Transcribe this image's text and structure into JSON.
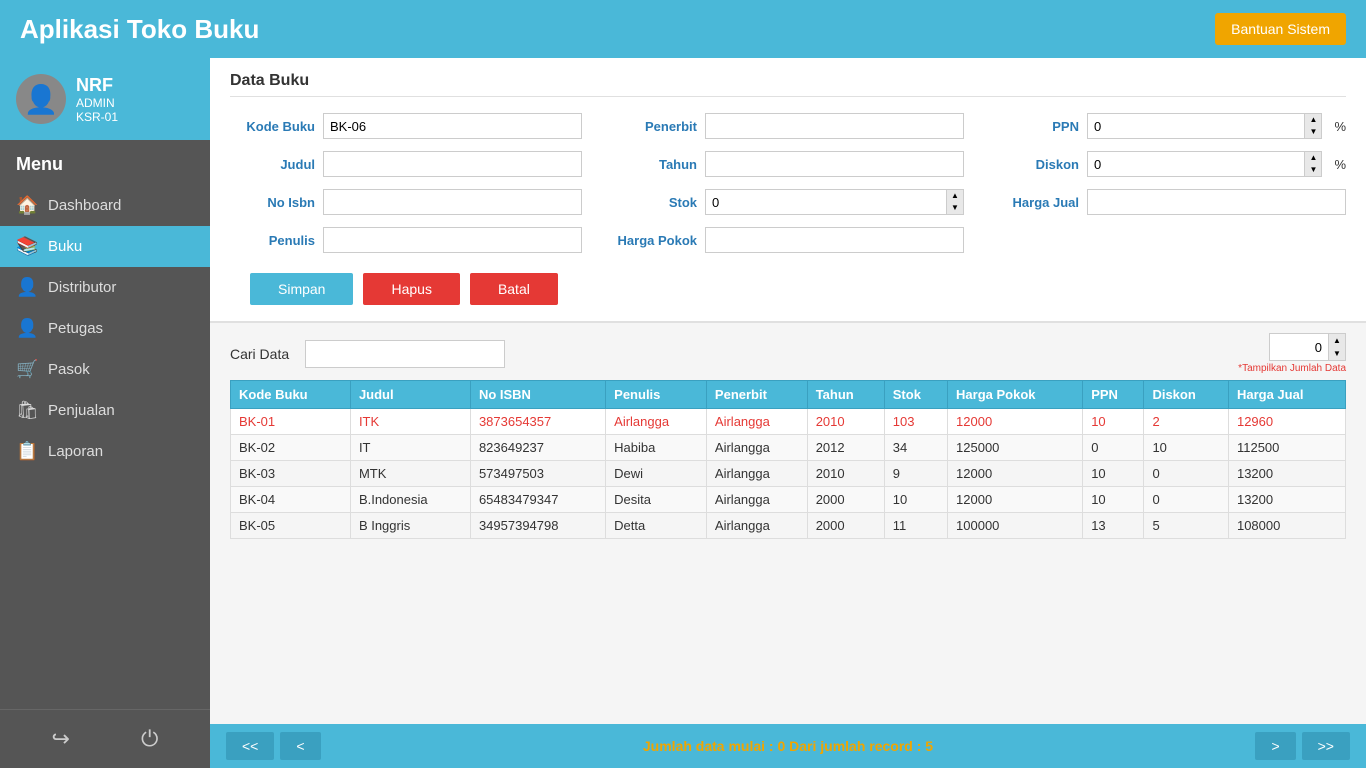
{
  "app": {
    "title": "Aplikasi Toko Buku",
    "help_btn": "Bantuan Sistem"
  },
  "sidebar": {
    "user": {
      "name": "NRF",
      "role": "ADMIN",
      "id": "KSR-01"
    },
    "menu_header": "Menu",
    "items": [
      {
        "id": "dashboard",
        "label": "Dashboard",
        "icon": "🏠"
      },
      {
        "id": "buku",
        "label": "Buku",
        "icon": "📚"
      },
      {
        "id": "distributor",
        "label": "Distributor",
        "icon": "👤"
      },
      {
        "id": "petugas",
        "label": "Petugas",
        "icon": "👤"
      },
      {
        "id": "pasok",
        "label": "Pasok",
        "icon": "🛒"
      },
      {
        "id": "penjualan",
        "label": "Penjualan",
        "icon": "🛍"
      },
      {
        "id": "laporan",
        "label": "Laporan",
        "icon": "📋"
      }
    ]
  },
  "panel": {
    "title": "Data Buku",
    "form": {
      "kode_buku_label": "Kode Buku",
      "kode_buku_value": "BK-06",
      "judul_label": "Judul",
      "judul_value": "",
      "no_isbn_label": "No Isbn",
      "no_isbn_value": "",
      "penulis_label": "Penulis",
      "penulis_value": "",
      "penerbit_label": "Penerbit",
      "penerbit_value": "",
      "tahun_label": "Tahun",
      "tahun_value": "",
      "stok_label": "Stok",
      "stok_value": "0",
      "harga_pokok_label": "Harga Pokok",
      "harga_pokok_value": "",
      "ppn_label": "PPN",
      "ppn_value": "0",
      "ppn_unit": "%",
      "diskon_label": "Diskon",
      "diskon_value": "0",
      "diskon_unit": "%",
      "harga_jual_label": "Harga Jual",
      "harga_jual_value": ""
    },
    "buttons": {
      "simpan": "Simpan",
      "hapus": "Hapus",
      "batal": "Batal"
    }
  },
  "table_section": {
    "search_label": "Cari Data",
    "search_placeholder": "",
    "show_count_value": "0",
    "show_count_note": "*Tampilkan Jumlah Data",
    "columns": [
      "Kode Buku",
      "Judul",
      "No ISBN",
      "Penulis",
      "Penerbit",
      "Tahun",
      "Stok",
      "Harga Pokok",
      "PPN",
      "Diskon",
      "Harga Jual"
    ],
    "rows": [
      {
        "kode": "BK-01",
        "judul": "ITK",
        "isbn": "3873654357",
        "penulis": "Airlangga",
        "penerbit": "Airlangga",
        "tahun": "2010",
        "stok": "103",
        "harga_pokok": "12000",
        "ppn": "10",
        "diskon": "2",
        "harga_jual": "12960",
        "selected": true
      },
      {
        "kode": "BK-02",
        "judul": "IT",
        "isbn": "823649237",
        "penulis": "Habiba",
        "penerbit": "Airlangga",
        "tahun": "2012",
        "stok": "34",
        "harga_pokok": "125000",
        "ppn": "0",
        "diskon": "10",
        "harga_jual": "112500",
        "selected": false
      },
      {
        "kode": "BK-03",
        "judul": "MTK",
        "isbn": "573497503",
        "penulis": "Dewi",
        "penerbit": "Airlangga",
        "tahun": "2010",
        "stok": "9",
        "harga_pokok": "12000",
        "ppn": "10",
        "diskon": "0",
        "harga_jual": "13200",
        "selected": false
      },
      {
        "kode": "BK-04",
        "judul": "B.Indonesia",
        "isbn": "65483479347",
        "penulis": "Desita",
        "penerbit": "Airlangga",
        "tahun": "2000",
        "stok": "10",
        "harga_pokok": "12000",
        "ppn": "10",
        "diskon": "0",
        "harga_jual": "13200",
        "selected": false
      },
      {
        "kode": "BK-05",
        "judul": "B Inggris",
        "isbn": "34957394798",
        "penulis": "Detta",
        "penerbit": "Airlangga",
        "tahun": "2000",
        "stok": "11",
        "harga_pokok": "100000",
        "ppn": "13",
        "diskon": "5",
        "harga_jual": "108000",
        "selected": false
      }
    ]
  },
  "pagination": {
    "first": "<<",
    "prev": "<",
    "next": ">",
    "last": ">>",
    "info": "Jumlah data mulai : 0 Dari jumlah record : 5"
  }
}
